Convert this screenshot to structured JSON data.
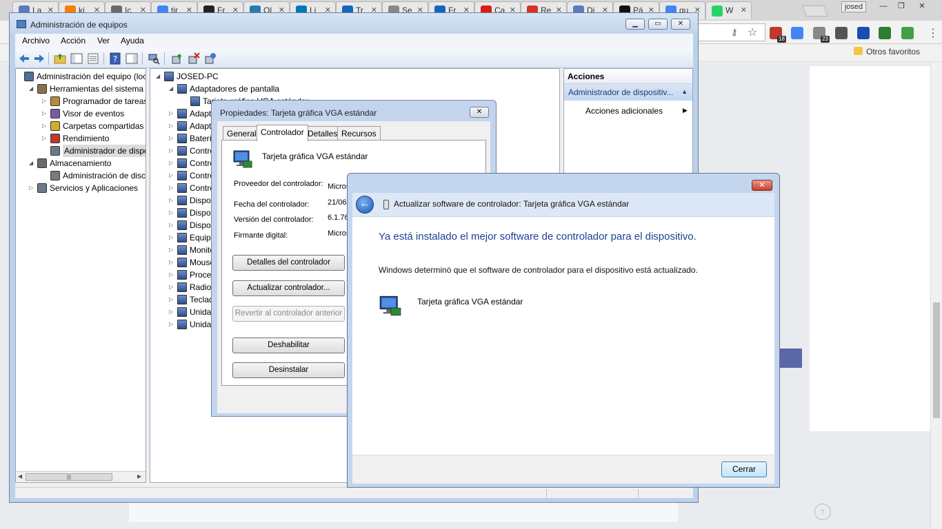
{
  "browser": {
    "tabs": [
      {
        "label": "La",
        "icon": "document-icon",
        "color": "#5b7bbf"
      },
      {
        "label": "ki",
        "icon": "blogger-icon",
        "color": "#f57d00"
      },
      {
        "label": "Ic",
        "icon": "globe-icon",
        "color": "#6a6a6a"
      },
      {
        "label": "tir",
        "icon": "google-icon",
        "color": "#4285f4"
      },
      {
        "label": "Fr",
        "icon": "gt-icon",
        "color": "#222222"
      },
      {
        "label": "Ol",
        "icon": "globe-icon",
        "color": "#2a7ab0"
      },
      {
        "label": "Li",
        "icon": "linkedin-icon",
        "color": "#0077b5"
      },
      {
        "label": "Tr",
        "icon": "info-icon",
        "color": "#1565c0"
      },
      {
        "label": "Se",
        "icon": "page-icon",
        "color": "#888888"
      },
      {
        "label": "Fr",
        "icon": "info-icon",
        "color": "#1565c0"
      },
      {
        "label": "Ca",
        "icon": "angular-icon",
        "color": "#dd1b16"
      },
      {
        "label": "Re",
        "icon": "gmail-icon",
        "color": "#d93025"
      },
      {
        "label": "Di",
        "icon": "document-icon",
        "color": "#5b7bbf"
      },
      {
        "label": "Pá",
        "icon": "cursor-icon",
        "color": "#111111"
      },
      {
        "label": "qu",
        "icon": "google-icon",
        "color": "#4285f4"
      },
      {
        "label": "W",
        "icon": "whatsapp-icon",
        "color": "#25d366"
      }
    ],
    "user": "josed",
    "bookmark_other": "Otros favoritos",
    "extensions": [
      {
        "name": "adblock-icon",
        "badge": "18",
        "color": "#c0392b"
      },
      {
        "name": "translate-icon",
        "badge": "",
        "color": "#4285f4"
      },
      {
        "name": "extension-icon",
        "badge": "23",
        "color": "#888888"
      },
      {
        "name": "refresh-icon",
        "badge": "",
        "color": "#555555"
      },
      {
        "name": "bookmark-icon",
        "badge": "",
        "color": "#1a4db0"
      },
      {
        "name": "torrent-icon",
        "badge": "",
        "color": "#2e7d32"
      },
      {
        "name": "chat-icon",
        "badge": "",
        "color": "#43a047"
      }
    ]
  },
  "mmc": {
    "title": "Administración de equipos",
    "menu": [
      "Archivo",
      "Acción",
      "Ver",
      "Ayuda"
    ],
    "left_tree": [
      {
        "label": "Administración del equipo (loc",
        "level": 0,
        "exp": "",
        "icon": "computer-management-icon",
        "color": "#4e6f9e"
      },
      {
        "label": "Herramientas del sistema",
        "level": 1,
        "exp": "◢",
        "icon": "tools-icon",
        "color": "#8d6e4a"
      },
      {
        "label": "Programador de tareas",
        "level": 2,
        "exp": "▷",
        "icon": "clock-icon",
        "color": "#b58a3c"
      },
      {
        "label": "Visor de eventos",
        "level": 2,
        "exp": "▷",
        "icon": "event-viewer-icon",
        "color": "#7a5a9e"
      },
      {
        "label": "Carpetas compartidas",
        "level": 2,
        "exp": "▷",
        "icon": "shared-folder-icon",
        "color": "#d9a92a"
      },
      {
        "label": "Rendimiento",
        "level": 2,
        "exp": "▷",
        "icon": "performance-icon",
        "color": "#c0392b"
      },
      {
        "label": "Administrador de dispo",
        "level": 2,
        "exp": "",
        "icon": "device-manager-icon",
        "color": "#6a7a8a",
        "selected": true
      },
      {
        "label": "Almacenamiento",
        "level": 1,
        "exp": "◢",
        "icon": "storage-icon",
        "color": "#6a6a6a"
      },
      {
        "label": "Administración de disco",
        "level": 2,
        "exp": "",
        "icon": "disk-icon",
        "color": "#7a7a7a"
      },
      {
        "label": "Servicios y Aplicaciones",
        "level": 1,
        "exp": "▷",
        "icon": "services-icon",
        "color": "#6c7a89"
      }
    ],
    "mid_tree": [
      {
        "label": "JOSED-PC",
        "level": 0,
        "exp": "◢",
        "icon": "computer-icon"
      },
      {
        "label": "Adaptadores de pantalla",
        "level": 1,
        "exp": "◢",
        "icon": "display-adapter-icon"
      },
      {
        "label": "Tarjeta gráfica VGA estándar",
        "level": 2,
        "exp": "",
        "icon": "monitor-icon"
      },
      {
        "label": "Adaptadores de red",
        "level": 1,
        "exp": "▷",
        "icon": "network-adapter-icon"
      },
      {
        "label": "Adaptadores de audio",
        "level": 1,
        "exp": "▷",
        "icon": "audio-icon"
      },
      {
        "label": "Baterías",
        "level": 1,
        "exp": "▷",
        "icon": "battery-icon"
      },
      {
        "label": "Controladoras ATA/ATAPI",
        "level": 1,
        "exp": "▷",
        "icon": "ide-controller-icon"
      },
      {
        "label": "Controladoras de bus serie universal",
        "level": 1,
        "exp": "▷",
        "icon": "usb-icon"
      },
      {
        "label": "Controladoras de almacenamiento",
        "level": 1,
        "exp": "▷",
        "icon": "storage-controller-icon"
      },
      {
        "label": "Controladoras de sonido y vídeo",
        "level": 1,
        "exp": "▷",
        "icon": "speaker-icon"
      },
      {
        "label": "Dispositivos de imagen",
        "level": 1,
        "exp": "▷",
        "icon": "camera-icon"
      },
      {
        "label": "Dispositivos del sistema",
        "level": 1,
        "exp": "▷",
        "icon": "system-device-icon"
      },
      {
        "label": "Dispositivos de interfaz humana",
        "level": 1,
        "exp": "▷",
        "icon": "hid-icon"
      },
      {
        "label": "Equipo",
        "level": 1,
        "exp": "▷",
        "icon": "computer-icon"
      },
      {
        "label": "Monitores",
        "level": 1,
        "exp": "▷",
        "icon": "monitor-icon"
      },
      {
        "label": "Mouse y otros dispositivos señaladores",
        "level": 1,
        "exp": "▷",
        "icon": "mouse-icon"
      },
      {
        "label": "Procesadores",
        "level": 1,
        "exp": "▷",
        "icon": "processor-icon"
      },
      {
        "label": "Radios Bluetooth",
        "level": 1,
        "exp": "▷",
        "icon": "bluetooth-icon"
      },
      {
        "label": "Teclados",
        "level": 1,
        "exp": "▷",
        "icon": "keyboard-icon"
      },
      {
        "label": "Unidades de disco",
        "level": 1,
        "exp": "▷",
        "icon": "disk-drive-icon"
      },
      {
        "label": "Unidades de DVD o CD-ROM",
        "level": 1,
        "exp": "▷",
        "icon": "dvd-icon"
      }
    ],
    "actions": {
      "title": "Acciones",
      "section": "Administrador de dispositiv...",
      "more": "Acciones adicionales"
    }
  },
  "props": {
    "title": "Propiedades: Tarjeta gráfica VGA estándar",
    "tabs": [
      "General",
      "Controlador",
      "Detalles",
      "Recursos"
    ],
    "active_tab": 1,
    "device_name": "Tarjeta gráfica VGA estándar",
    "rows": [
      {
        "label": "Proveedor del controlador:",
        "value": "Micros"
      },
      {
        "label": "Fecha del controlador:",
        "value": "21/06"
      },
      {
        "label": "Versión del controlador:",
        "value": "6.1.76"
      },
      {
        "label": "Firmante digital:",
        "value": "Micros"
      }
    ],
    "buttons": {
      "details": "Detalles del controlador",
      "update": "Actualizar controlador...",
      "rollback": "Revertir al controlador anterior",
      "disable": "Deshabilitar",
      "uninstall": "Desinstalar"
    }
  },
  "wizard": {
    "close_glyph": "✕",
    "header_title": "Actualizar software de controlador: Tarjeta gráfica VGA estándar",
    "heading": "Ya está instalado el mejor software de controlador para el dispositivo.",
    "description": "Windows determinó que el software de controlador para el dispositivo está actualizado.",
    "device_name": "Tarjeta gráfica VGA estándar",
    "close_button": "Cerrar"
  }
}
